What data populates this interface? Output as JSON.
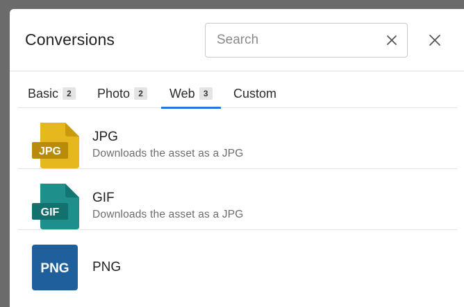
{
  "dialog": {
    "title": "Conversions",
    "search": {
      "placeholder": "Search",
      "value": ""
    },
    "icons": {
      "clear": "close-x-icon",
      "close": "close-x-icon"
    }
  },
  "tabs": [
    {
      "label": "Basic",
      "count": "2",
      "active": false
    },
    {
      "label": "Photo",
      "count": "2",
      "active": false
    },
    {
      "label": "Web",
      "count": "3",
      "active": true
    },
    {
      "label": "Custom",
      "count": "",
      "active": false
    }
  ],
  "items": [
    {
      "title": "JPG",
      "description": "Downloads the asset as a JPG",
      "icon_text": "JPG",
      "icon": "jpg-file-icon",
      "color": "#e6b81e"
    },
    {
      "title": "GIF",
      "description": "Downloads the asset as a JPG",
      "icon_text": "GIF",
      "icon": "gif-file-icon",
      "color": "#1e8f8a"
    },
    {
      "title": "PNG",
      "description": "",
      "icon_text": "PNG",
      "icon": "png-file-icon",
      "color": "#1f5f9c"
    }
  ],
  "colors": {
    "accent": "#1f7ae0",
    "jpg": "#e6b81e",
    "gif": "#1e8f8a",
    "png": "#1f5f9c"
  }
}
